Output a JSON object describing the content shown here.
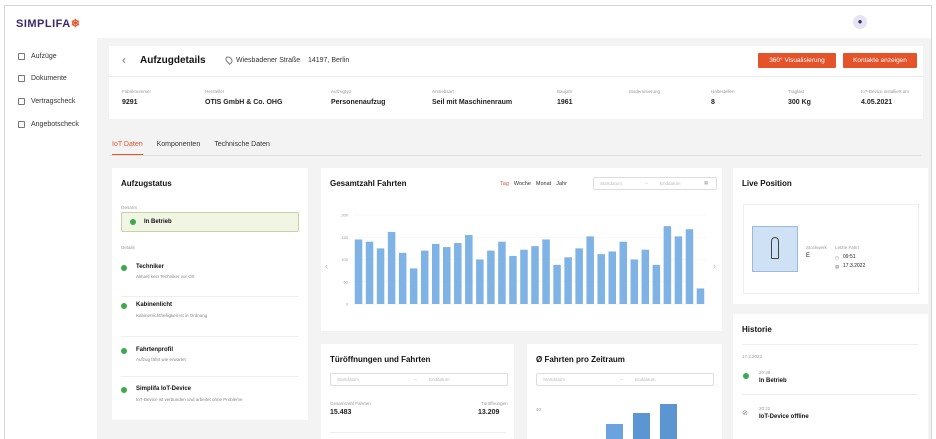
{
  "brand": {
    "logo_text": "SIMPLIFA",
    "logo_mark": "❄",
    "accent": "#e5532b"
  },
  "user": {
    "avatar_icon": "user-icon"
  },
  "sidebar": {
    "items": [
      {
        "label": "Aufzüge",
        "icon": "elevator-icon"
      },
      {
        "label": "Dokumente",
        "icon": "document-icon"
      },
      {
        "label": "Vertragscheck",
        "icon": "contract-icon"
      },
      {
        "label": "Angebotscheck",
        "icon": "offer-icon"
      }
    ]
  },
  "header": {
    "back": "‹",
    "title": "Aufzugdetails",
    "street": "Wiesbadener Straße",
    "city": "14197, Berlin",
    "btn_360": "360° Visualisierung",
    "btn_contacts": "Kontakte anzeigen"
  },
  "info": [
    {
      "label": "Fabriknummer",
      "value": "9291"
    },
    {
      "label": "Hersteller",
      "value": "OTIS GmbH & Co. OHG"
    },
    {
      "label": "Aufzugtyp",
      "value": "Personenaufzug"
    },
    {
      "label": "Antriebsart",
      "value": "Seil mit Maschinenraum"
    },
    {
      "label": "Baujahr",
      "value": "1961"
    },
    {
      "label": "Modernisierung",
      "value": ""
    },
    {
      "label": "Haltestellen",
      "value": "8"
    },
    {
      "label": "Traglast",
      "value": "300 Kg"
    },
    {
      "label": "IoT-Device installiert am",
      "value": "4.05.2021"
    }
  ],
  "tabs": [
    "IoT Daten",
    "Komponenten",
    "Technische Daten"
  ],
  "status": {
    "title": "Aufzugstatus",
    "current_label": "Gesamt",
    "current_value": "In Betrieb",
    "details_label": "Details",
    "items": [
      {
        "name": "Techniker",
        "desc": "Aktuell kein Techniker vor Ort"
      },
      {
        "name": "Kabinenlicht",
        "desc": "Kabinenlichthelligkeit ist in Ordnung"
      },
      {
        "name": "Fahrtenprofil",
        "desc": "Aufzug fährt wie erwartet"
      },
      {
        "name": "Simplifa IoT-Device",
        "desc": "IoT-Device ist verbunden und arbeitet ohne Probleme"
      }
    ]
  },
  "rides": {
    "title": "Gesamtzahl Fahrten",
    "filters": [
      "Tag",
      "Woche",
      "Monat",
      "Jahr"
    ],
    "start_placeholder": "Startdatum",
    "end_placeholder": "Enddatum"
  },
  "chart_data": {
    "type": "bar",
    "title": "Gesamtzahl Fahrten",
    "ylim": [
      0,
      200
    ],
    "yticks": [
      0,
      50,
      100,
      150,
      200
    ],
    "color": "#7fb2e5",
    "values": [
      145,
      140,
      125,
      162,
      115,
      80,
      120,
      135,
      128,
      137,
      155,
      100,
      120,
      140,
      108,
      122,
      130,
      145,
      88,
      105,
      125,
      152,
      112,
      118,
      140,
      100,
      122,
      88,
      175,
      152,
      168,
      35
    ]
  },
  "live": {
    "title": "Live Position",
    "floor_label": "Stockwerk",
    "floor_value": "E",
    "last_ride_label": "Letzte Fahrt",
    "time": "09:51",
    "date": "17.3.2022"
  },
  "history": {
    "title": "Historie",
    "date": "17.3.2022",
    "entries": [
      {
        "time": "20:36",
        "text": "In Betrieb"
      },
      {
        "time": "20:22",
        "text": "IoT-Device offline"
      }
    ]
  },
  "doors": {
    "title": "Türöffnungen und Fahrten",
    "start_placeholder": "Startdatum",
    "end_placeholder": "Enddatum",
    "rides_label": "Gesamtzahl Fahrten",
    "rides_value": "15.483",
    "doors_label": "Türöffnungen",
    "doors_value": "13.209"
  },
  "avg": {
    "title": "Ø Fahrten pro Zeitraum",
    "start_placeholder": "Startdatum",
    "end_placeholder": "Enddatum",
    "ytick": "40"
  }
}
